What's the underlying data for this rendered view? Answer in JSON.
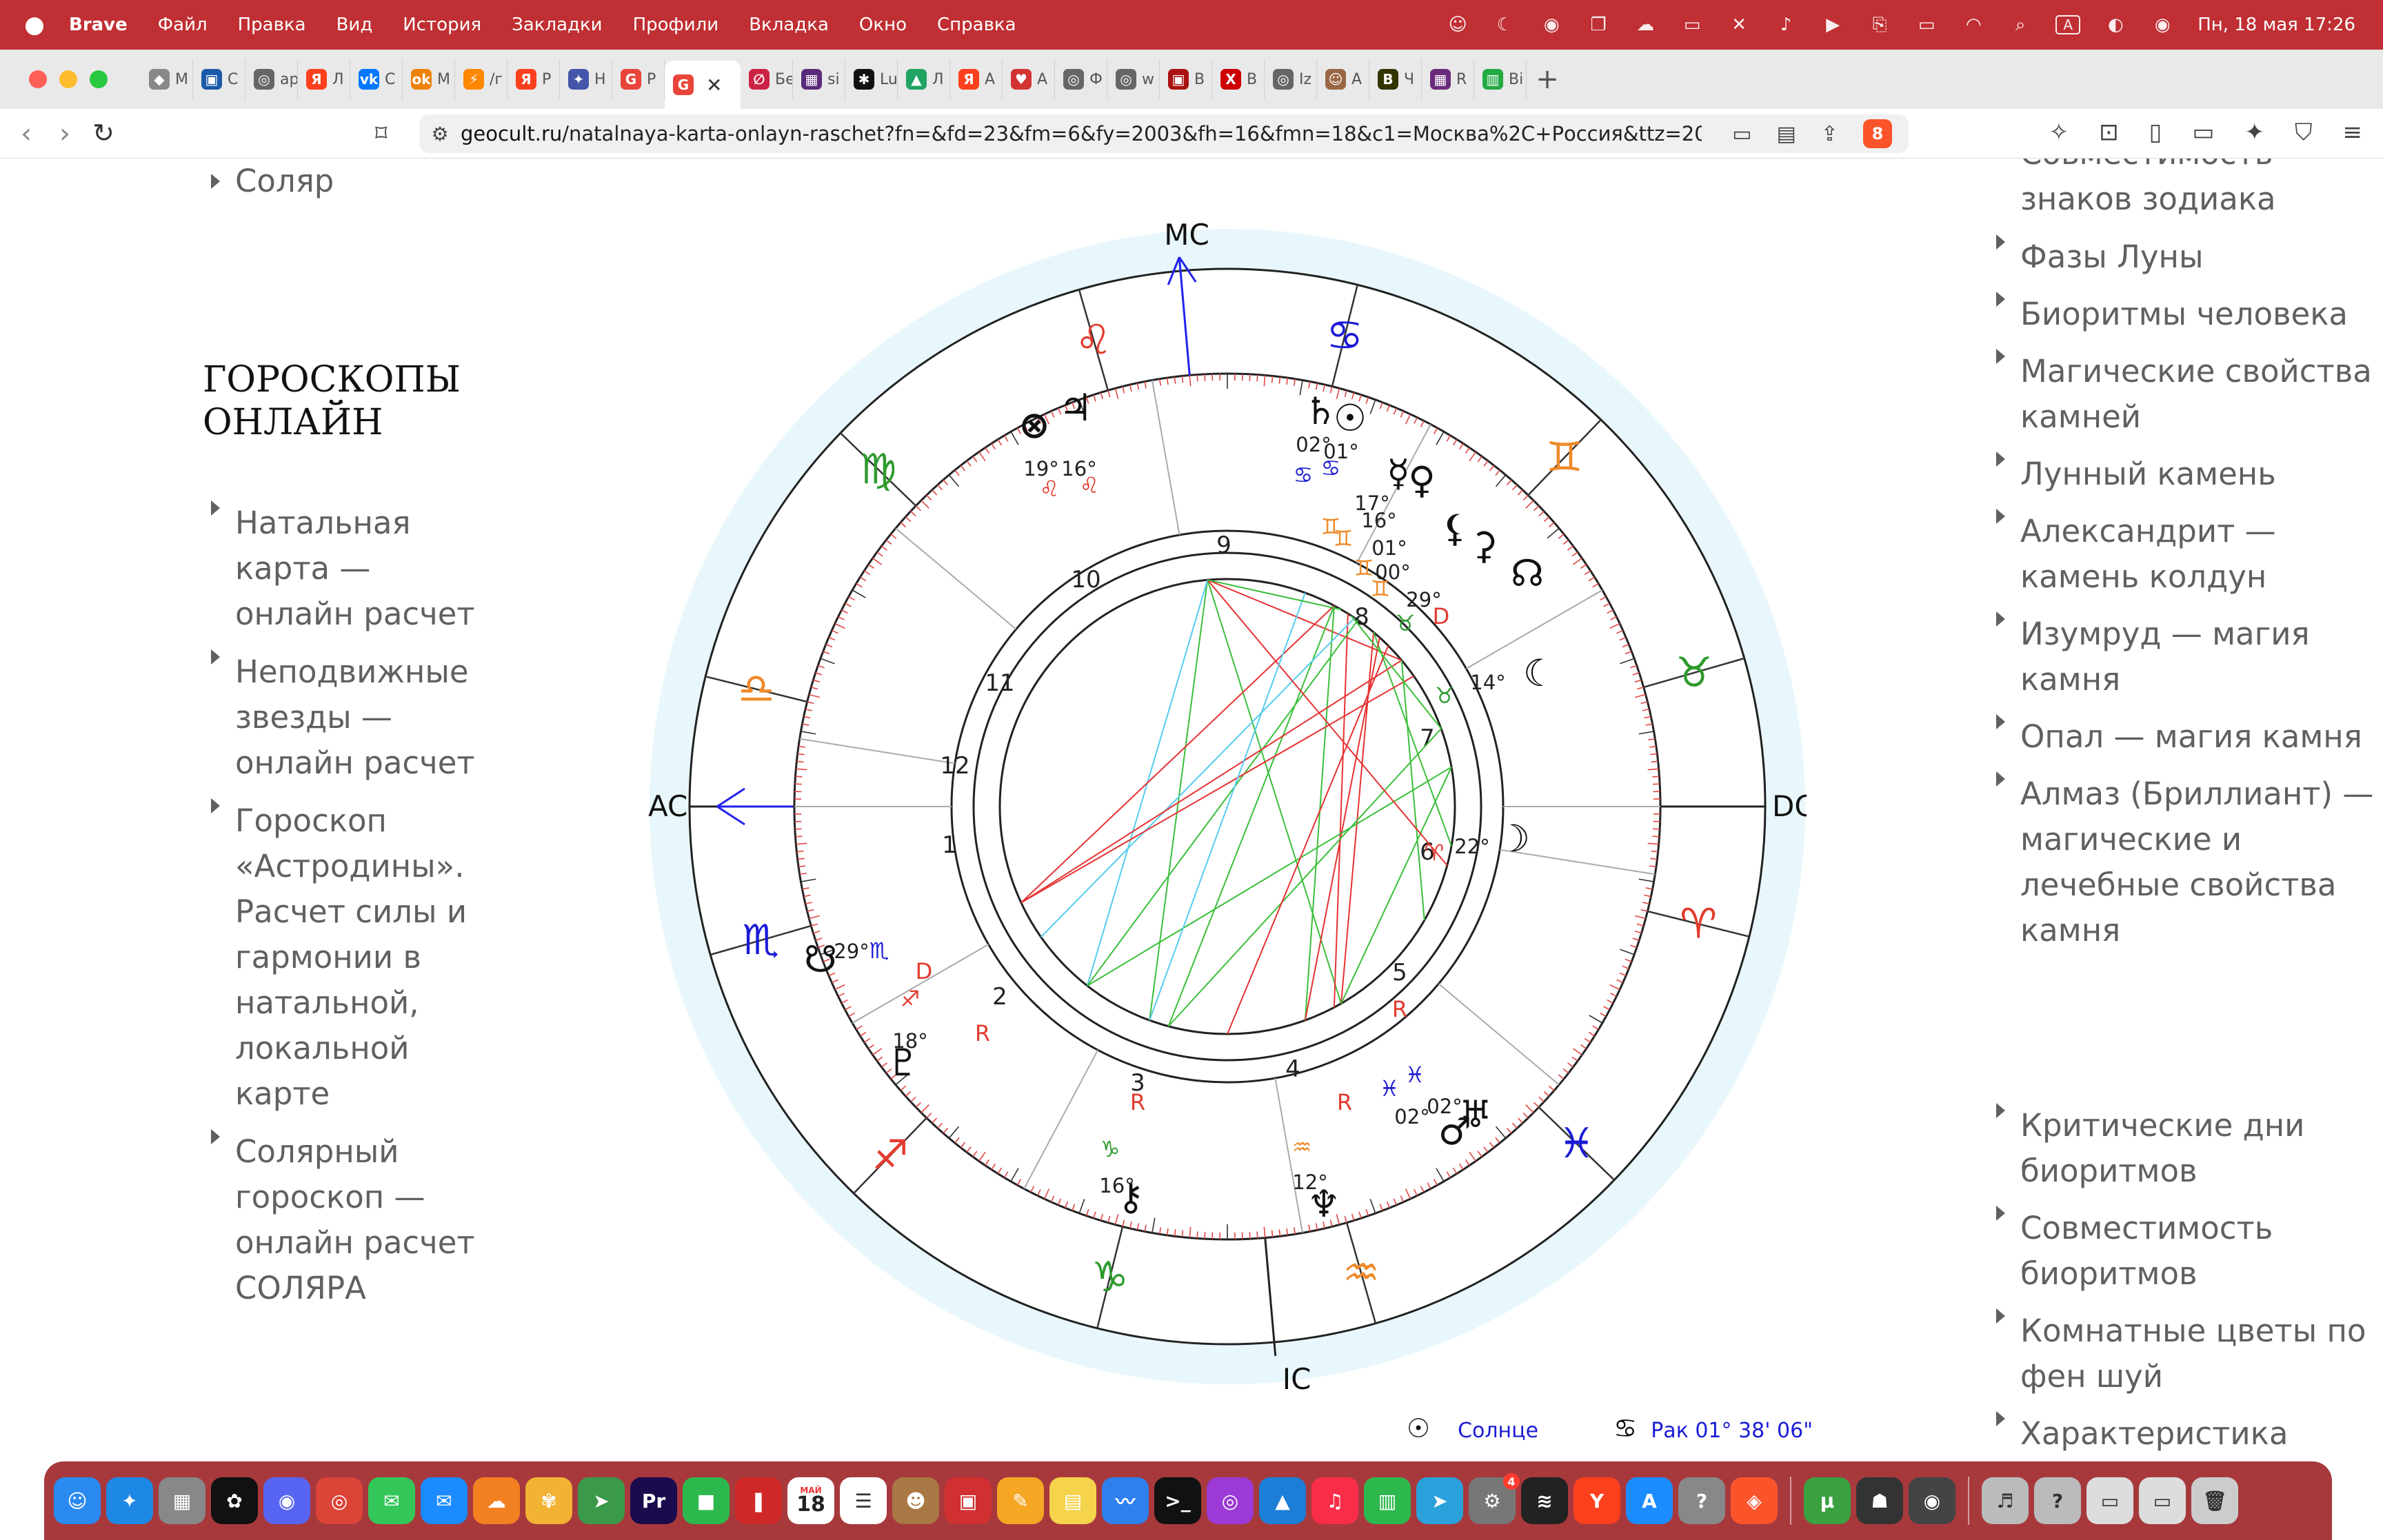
{
  "menubar": {
    "app_name": "Brave",
    "items": [
      "Файл",
      "Правка",
      "Вид",
      "История",
      "Закладки",
      "Профили",
      "Вкладка",
      "Окно",
      "Справка"
    ],
    "clock": "Пн, 18 мая  17:26",
    "status_icons": [
      "app-avatar-icon",
      "moon-icon",
      "vpn-icon",
      "screen-mirror-icon",
      "cloud-icon",
      "display-icon",
      "mute-icon",
      "volume-icon",
      "play-icon",
      "clipboard-icon",
      "battery-icon",
      "wifi-icon",
      "search-icon",
      "input-source-icon",
      "control-center-icon",
      "siri-icon"
    ],
    "input_source": "A"
  },
  "tabs": [
    {
      "label": "M",
      "color": "#888888",
      "glyph": "◆"
    },
    {
      "label": "C",
      "color": "#1a5aa8",
      "glyph": "▣"
    },
    {
      "label": "ap",
      "color": "#666666",
      "glyph": "◎"
    },
    {
      "label": "Л",
      "color": "#fc3f1d",
      "glyph": "Я"
    },
    {
      "label": "C",
      "color": "#0077ff",
      "glyph": "vk"
    },
    {
      "label": "M",
      "color": "#ee8208",
      "glyph": "ok"
    },
    {
      "label": "/г",
      "color": "#ff8800",
      "glyph": "⚡"
    },
    {
      "label": "Р",
      "color": "#fc3f1d",
      "glyph": "Я"
    },
    {
      "label": "Н",
      "color": "#4455aa",
      "glyph": "✦"
    },
    {
      "label": "Р",
      "color": "#e8443a",
      "glyph": "G"
    },
    {
      "label": "",
      "color": "#e8443a",
      "glyph": "G",
      "active": true
    },
    {
      "label": "Бе",
      "color": "#cc2244",
      "glyph": "∅"
    },
    {
      "label": "si",
      "color": "#5a2a7a",
      "glyph": "▦"
    },
    {
      "label": "Lu",
      "color": "#111111",
      "glyph": "✱"
    },
    {
      "label": "Л",
      "color": "#1fa463",
      "glyph": "▲"
    },
    {
      "label": "А",
      "color": "#fc3f1d",
      "glyph": "Я"
    },
    {
      "label": "А",
      "color": "#d33333",
      "glyph": "♥"
    },
    {
      "label": "Ф",
      "color": "#666666",
      "glyph": "◎"
    },
    {
      "label": "w",
      "color": "#666666",
      "glyph": "◎"
    },
    {
      "label": "В",
      "color": "#aa1111",
      "glyph": "▣"
    },
    {
      "label": "В",
      "color": "#cc0000",
      "glyph": "X"
    },
    {
      "label": "Iz",
      "color": "#666666",
      "glyph": "◎"
    },
    {
      "label": "А",
      "color": "#996644",
      "glyph": "☺"
    },
    {
      "label": "Ч",
      "color": "#333300",
      "glyph": "B"
    },
    {
      "label": "R",
      "color": "#6a2a7a",
      "glyph": "▦"
    },
    {
      "label": "Ві",
      "color": "#22aa44",
      "glyph": "▥"
    }
  ],
  "toolbar": {
    "url_host": "geocult.ru",
    "url_path": "/natalnaya-karta-onlayn-raschet?fn=&fd=23&fm=6&fy=2003&fh=16&fmn=18&c1=Москва%2C+Россия&ttz=20&tz=Europe...",
    "shield_count": "8"
  },
  "left_sidebar": {
    "top_link": "Соляр",
    "section_title": "ГОРОСКОПЫ ОНЛАЙН",
    "links": [
      "Натальная карта — онлайн расчет",
      "Неподвижные звезды — онлайн расчет",
      "Гороскоп «Астродины». Расчет силы и гармонии в натальной, локальной карте",
      "Солярный гороскоп — онлайн расчет СОЛЯРА"
    ]
  },
  "right_sidebar": {
    "partial_top": "Совместимость знаков зодиака",
    "links_top": [
      "Фазы Луны",
      "Биоритмы человека",
      "Магические свойства камней",
      "Лунный камень",
      "Александрит — камень колдун",
      "Изумруд — магия камня",
      "Опал — магия камня",
      "Алмаз (Бриллиант) — магические и лечебные свойства камня"
    ],
    "links_bottom": [
      "Критические дни биоритмов",
      "Совместимость биоритмов",
      "Комнатные цветы по фен шуй",
      "Характеристика"
    ]
  },
  "natal_chart": {
    "angles": {
      "mc": "MC",
      "ac": "AC",
      "dc": "DC",
      "ic": "IC"
    },
    "houses": [
      "1",
      "2",
      "3",
      "4",
      "5",
      "6",
      "7",
      "8",
      "9",
      "10",
      "11",
      "12"
    ],
    "zodiac_signs": [
      "♌",
      "♋",
      "♊",
      "♉",
      "♈",
      "♓",
      "♒",
      "♑",
      "♐",
      "♏",
      "♎",
      "♍"
    ],
    "planets": [
      {
        "glyph": "⊗",
        "deg": "19°",
        "sign": "♌",
        "name": "Парс фортуны"
      },
      {
        "glyph": "♃",
        "deg": "16°",
        "sign": "♌",
        "name": "Юпитер"
      },
      {
        "glyph": "♄",
        "deg": "02°",
        "sign": "♋",
        "name": "Сатурн"
      },
      {
        "glyph": "☉",
        "deg": "01°",
        "sign": "♋",
        "name": "Солнце"
      },
      {
        "glyph": "☿",
        "deg": "17°",
        "sign": "♊",
        "name": "Меркурий"
      },
      {
        "glyph": "♀",
        "deg": "16°",
        "sign": "♊",
        "name": "Венера"
      },
      {
        "glyph": "⚸",
        "deg": "01°",
        "sign": "♊",
        "name": "Лилит"
      },
      {
        "glyph": "⚳",
        "deg": "00°",
        "sign": "♊",
        "name": "Церера"
      },
      {
        "glyph": "☊",
        "deg": "29°",
        "sign": "♉",
        "name": "Восходящий узел"
      },
      {
        "glyph": "☾",
        "deg": "14°",
        "sign": "♉",
        "name": "Селена"
      },
      {
        "glyph": "☽",
        "deg": "22°",
        "sign": "♈",
        "name": "Луна"
      },
      {
        "glyph": "♅",
        "deg": "02°",
        "sign": "♓",
        "name": "Уран"
      },
      {
        "glyph": "♂",
        "deg": "02°",
        "sign": "♓",
        "name": "Марс"
      },
      {
        "glyph": "♆",
        "deg": "12°",
        "sign": "♒",
        "name": "Нептун"
      },
      {
        "glyph": "⚷",
        "deg": "16°",
        "sign": "♑",
        "name": "Хирон"
      },
      {
        "glyph": "♇",
        "deg": "18°",
        "sign": "♐",
        "name": "Плутон"
      },
      {
        "glyph": "☋",
        "deg": "29°",
        "sign": "♏",
        "name": "Нисходящий узел"
      }
    ],
    "retro_markers": [
      "R",
      "R",
      "R",
      "R",
      "D",
      "D"
    ],
    "colors": {
      "fire": "#e23b2e",
      "earth": "#2e9a2e",
      "air": "#ee8a2a",
      "water": "#1b1bd6",
      "halo": "#e8f7fb",
      "aspect_red": "#e63232",
      "aspect_green": "#3bbf3b",
      "aspect_cyan": "#55ccee"
    }
  },
  "chart_legend": {
    "glyph": "☉",
    "label": "Солнце",
    "sign_glyph": "♋",
    "position": "Рак 01° 38' 06\""
  },
  "dock": {
    "apps": [
      {
        "name": "finder",
        "color": "#2a8af0",
        "glyph": "☺"
      },
      {
        "name": "safari",
        "color": "#1e88e5",
        "glyph": "✦"
      },
      {
        "name": "launchpad",
        "color": "#888888",
        "glyph": "▦"
      },
      {
        "name": "chatgpt",
        "color": "#111111",
        "glyph": "✿"
      },
      {
        "name": "discord",
        "color": "#5865f2",
        "glyph": "◉"
      },
      {
        "name": "chrome",
        "color": "#db4437",
        "glyph": "◎"
      },
      {
        "name": "messages",
        "color": "#33c759",
        "glyph": "✉"
      },
      {
        "name": "mail",
        "color": "#1a8cff",
        "glyph": "✉"
      },
      {
        "name": "cloudflare",
        "color": "#f38020",
        "glyph": "☁"
      },
      {
        "name": "photos",
        "color": "#f2b233",
        "glyph": "✾"
      },
      {
        "name": "maps",
        "color": "#3b9a4a",
        "glyph": "➤"
      },
      {
        "name": "premiere",
        "color": "#1a0b4d",
        "glyph": "Pr"
      },
      {
        "name": "facetime",
        "color": "#2db84d",
        "glyph": "■"
      },
      {
        "name": "photo-booth",
        "color": "#d02828",
        "glyph": "❚"
      },
      {
        "name": "calendar",
        "color": "#ffffff",
        "glyph": "18",
        "label": "МАЙ"
      },
      {
        "name": "reminders",
        "color": "#ffffff",
        "glyph": "☰"
      },
      {
        "name": "contacts",
        "color": "#a87845",
        "glyph": "☻"
      },
      {
        "name": "photo-tool",
        "color": "#d03030",
        "glyph": "▣"
      },
      {
        "name": "pages",
        "color": "#f5a623",
        "glyph": "✎"
      },
      {
        "name": "notes",
        "color": "#f5d34a",
        "glyph": "▤"
      },
      {
        "name": "freeform",
        "color": "#2f80ed",
        "glyph": "〰"
      },
      {
        "name": "terminal",
        "color": "#111111",
        "glyph": ">_"
      },
      {
        "name": "podcasts",
        "color": "#9b3ad6",
        "glyph": "◎"
      },
      {
        "name": "keynote",
        "color": "#1c7ed6",
        "glyph": "▲"
      },
      {
        "name": "music",
        "color": "#fa2d48",
        "glyph": "♫"
      },
      {
        "name": "numbers",
        "color": "#2db84d",
        "glyph": "▥"
      },
      {
        "name": "telegram",
        "color": "#2aa1da",
        "glyph": "➤"
      },
      {
        "name": "system-settings",
        "color": "#777777",
        "glyph": "⚙",
        "badge": "4"
      },
      {
        "name": "voice-memos",
        "color": "#222222",
        "glyph": "≋"
      },
      {
        "name": "yandex",
        "color": "#fc3f1d",
        "glyph": "Y"
      },
      {
        "name": "app-store",
        "color": "#1a8cff",
        "glyph": "A"
      },
      {
        "name": "help",
        "color": "#888888",
        "glyph": "?"
      },
      {
        "name": "brave",
        "color": "#fb542b",
        "glyph": "◈"
      },
      {
        "name": "utorrent",
        "color": "#3aa040",
        "glyph": "μ"
      },
      {
        "name": "spy-app",
        "color": "#333333",
        "glyph": "☗"
      },
      {
        "name": "disk-utility",
        "color": "#444444",
        "glyph": "◉"
      },
      {
        "name": "downloads-folder",
        "color": "#bbbbbb",
        "glyph": "♬"
      },
      {
        "name": "unknown-folder",
        "color": "#bbbbbb",
        "glyph": "?"
      },
      {
        "name": "stack-1",
        "color": "#dddddd",
        "glyph": "▭"
      },
      {
        "name": "stack-2",
        "color": "#dddddd",
        "glyph": "▭"
      },
      {
        "name": "trash",
        "color": "#cccccc",
        "glyph": "🗑"
      }
    ]
  }
}
